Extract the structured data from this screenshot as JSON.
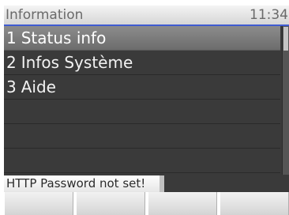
{
  "header": {
    "title": "Information",
    "clock": "11:34"
  },
  "menu": {
    "items": [
      {
        "number": "1",
        "label": "Status info",
        "selected": true
      },
      {
        "number": "2",
        "label": "Infos Système",
        "selected": false
      },
      {
        "number": "3",
        "label": "Aide",
        "selected": false
      }
    ],
    "empty_rows": 3
  },
  "status": {
    "message": "HTTP Password not set!"
  },
  "softkeys": [
    "",
    "",
    "",
    ""
  ],
  "colors": {
    "accent_line": "#3f5bd1",
    "menu_background": "#3a3a3a",
    "selected_row": "#7a7a7a"
  }
}
